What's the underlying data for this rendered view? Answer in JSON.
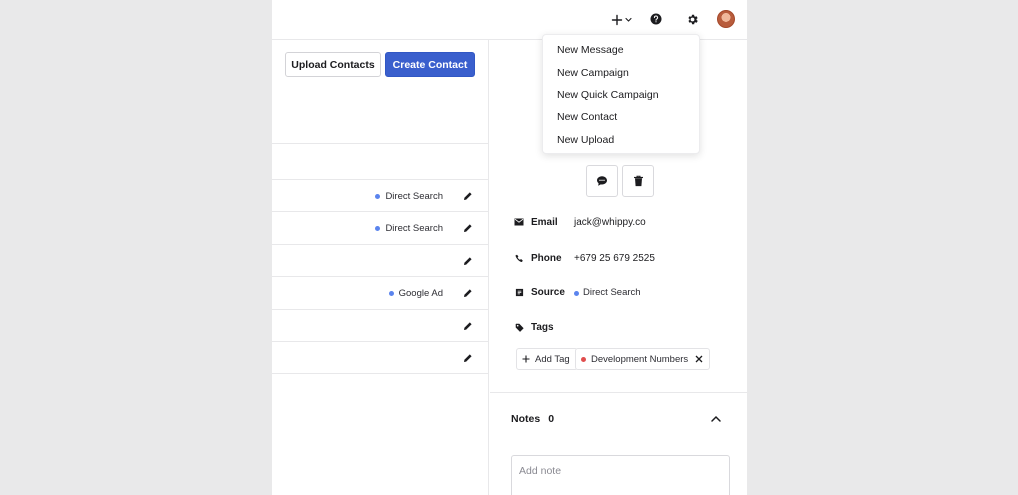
{
  "header": {
    "plus_menu_icon": "plus-chevron-icon",
    "help_icon": "help-icon",
    "settings_icon": "gear-icon"
  },
  "toolbar": {
    "upload_label": "Upload Contacts",
    "create_label": "Create Contact"
  },
  "contacts": {
    "rows": [
      {
        "source": "Direct Search",
        "source_color": "#5b84ee"
      },
      {
        "source": "Direct Search",
        "source_color": "#5b84ee"
      },
      {
        "source": ""
      },
      {
        "source": "Google Ad",
        "source_color": "#5b84ee"
      },
      {
        "source": ""
      },
      {
        "source": ""
      }
    ]
  },
  "new_menu": {
    "items": [
      "New Message",
      "New Campaign",
      "New Quick Campaign",
      "New Contact",
      "New Upload"
    ]
  },
  "contact": {
    "email_label": "Email",
    "email": "jack@whippy.co",
    "phone_label": "Phone",
    "phone": "+679 25 679 2525",
    "source_label": "Source",
    "source": "Direct Search",
    "tags_label": "Tags",
    "add_tag_label": "Add Tag",
    "tags": [
      {
        "label": "Development Numbers",
        "color": "#e04d4d"
      }
    ]
  },
  "notes": {
    "label": "Notes",
    "count": "0",
    "placeholder": "Add note"
  },
  "colors": {
    "accent": "#3a5fcd",
    "source_dot": "#5b84ee"
  }
}
